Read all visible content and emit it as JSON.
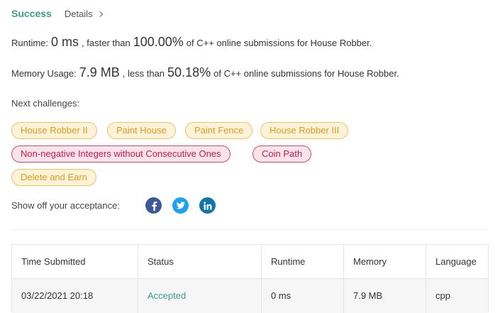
{
  "header": {
    "status": "Success",
    "details_label": "Details"
  },
  "runtime": {
    "label": "Runtime:",
    "value": "0 ms",
    "comparison": ", faster than",
    "percent": "100.00%",
    "suffix": "of C++ online submissions for House Robber."
  },
  "memory": {
    "label": "Memory Usage:",
    "value": "7.9 MB",
    "comparison": ", less than",
    "percent": "50.18%",
    "suffix": "of C++ online submissions for House Robber."
  },
  "next_challenges": {
    "label": "Next challenges:",
    "items": [
      {
        "label": "House Robber II",
        "difficulty": "easy"
      },
      {
        "label": "Paint House",
        "difficulty": "easy"
      },
      {
        "label": "Paint Fence",
        "difficulty": "easy"
      },
      {
        "label": "House Robber III",
        "difficulty": "easy"
      },
      {
        "label": "Non-negative Integers without Consecutive Ones",
        "difficulty": "hard"
      },
      {
        "label": "Coin Path",
        "difficulty": "hard"
      },
      {
        "label": "Delete and Earn",
        "difficulty": "easy"
      }
    ]
  },
  "share": {
    "label": "Show off your acceptance:",
    "icons": [
      "facebook-icon",
      "twitter-icon",
      "linkedin-icon"
    ]
  },
  "colors": {
    "success": "#3b9e86",
    "facebook": "#3b5998",
    "twitter": "#1da1f2",
    "linkedin": "#0e76a8"
  },
  "table": {
    "headers": [
      "Time Submitted",
      "Status",
      "Runtime",
      "Memory",
      "Language"
    ],
    "rows": [
      [
        "03/22/2021 20:18",
        "Accepted",
        "0 ms",
        "7.9 MB",
        "cpp"
      ]
    ]
  }
}
